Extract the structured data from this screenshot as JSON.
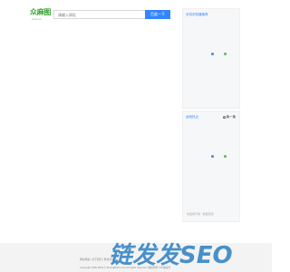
{
  "logo": {
    "main_text": "众麻图",
    "sub_text": "xxxxx.xxx",
    "accent_color": "#3aa335"
  },
  "search": {
    "placeholder": "请输入网址",
    "button_label": "百度一下",
    "button_color": "#3385ff"
  },
  "panels": [
    {
      "title": "手机浏览器推荐",
      "accent_color": "#3385ff"
    },
    {
      "title": "全网热点",
      "refresh_label": "换一换",
      "footer_note": "热度排行榜 · 数据来源"
    }
  ],
  "footer": {
    "line1": "网站导航 | 关于我们 | 联系方式",
    "line2": "Copyright 1995-2019 © ZhongMaTu.com All rights reserved. 版权所有 ICP备案号",
    "background": "#f3f3f3"
  },
  "watermark": {
    "text": "链发发SEO",
    "color": "#2a7fc4"
  },
  "icons": {
    "refresh": "refresh-icon",
    "loading_dot_1": "loading-dot-icon",
    "loading_dot_2": "loading-dot-icon"
  }
}
